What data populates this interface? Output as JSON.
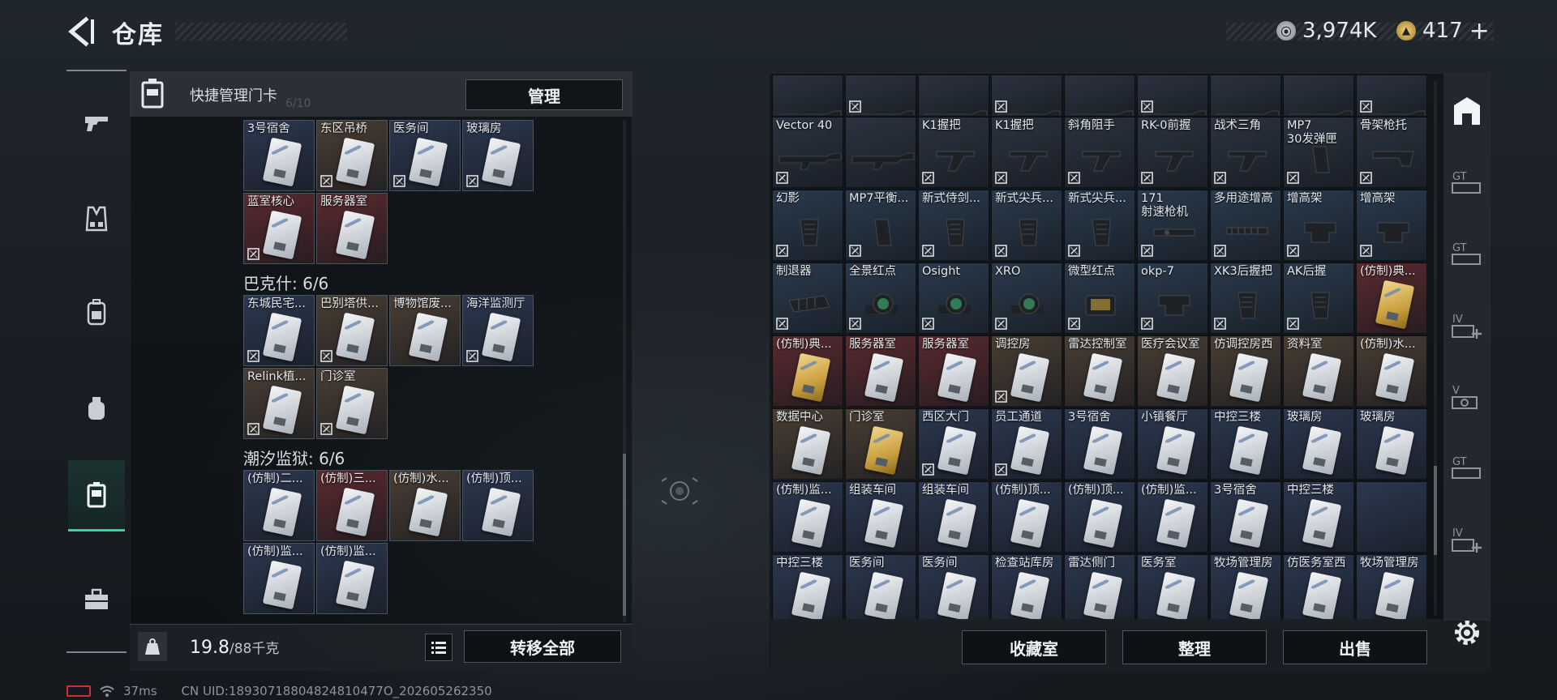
{
  "header": {
    "title": "仓库"
  },
  "currency": {
    "coins": "3,974K",
    "premium": "417",
    "plus": "+"
  },
  "left_nav": [
    "firearm",
    "gear",
    "backpack",
    "consumable",
    "keycard",
    "toolbox"
  ],
  "left_panel": {
    "header_label": "快捷管理门卡",
    "header_faded": "6/10",
    "manage_button": "管理",
    "weight_value": "19.8",
    "weight_max": "/88千克",
    "transfer_all_button": "转移全部",
    "group1_rows": [
      [
        {
          "label": "3号宿舍",
          "bg": "#2c3850",
          "card": "white",
          "locked": false
        },
        {
          "label": "东区吊桥",
          "bg": "#4a3e33",
          "card": "white",
          "locked": true
        },
        {
          "label": "医务间",
          "bg": "#2c3850",
          "card": "white",
          "locked": true
        },
        {
          "label": "玻璃房",
          "bg": "#2c3850",
          "card": "white",
          "locked": true
        }
      ],
      [
        {
          "label": "蓝室核心",
          "bg": "#5a2a2e",
          "card": "white",
          "locked": true
        },
        {
          "label": "服务器室",
          "bg": "#5a2a2e",
          "card": "white",
          "locked": false
        }
      ]
    ],
    "group2_title": "巴克什: 6/6",
    "group2_rows": [
      [
        {
          "label": "东城民宅...",
          "bg": "#2c3850",
          "card": "white",
          "locked": true
        },
        {
          "label": "巴别塔供...",
          "bg": "#4a3e33",
          "card": "white",
          "locked": true
        },
        {
          "label": "博物馆废...",
          "bg": "#4a3e33",
          "card": "white",
          "locked": false
        },
        {
          "label": "海洋监测厅",
          "bg": "#2c3850",
          "card": "white",
          "locked": true
        }
      ],
      [
        {
          "label": "Relink植...",
          "bg": "#4a3e33",
          "card": "white",
          "locked": true
        },
        {
          "label": "门诊室",
          "bg": "#4a3e33",
          "card": "white",
          "locked": true
        }
      ]
    ],
    "group3_title": "潮汐监狱: 6/6",
    "group3_rows": [
      [
        {
          "label": "(仿制)二...",
          "bg": "#2c3850",
          "card": "white",
          "locked": false
        },
        {
          "label": "(仿制)三...",
          "bg": "#5a2a2e",
          "card": "white",
          "locked": false
        },
        {
          "label": "(仿制)水...",
          "bg": "#4a3e33",
          "card": "white",
          "locked": false
        },
        {
          "label": "(仿制)顶...",
          "bg": "#2c3850",
          "card": "white",
          "locked": false
        }
      ],
      [
        {
          "label": "(仿制)监...",
          "bg": "#2c3850",
          "card": "white",
          "locked": false
        },
        {
          "label": "(仿制)监...",
          "bg": "#2c3850",
          "card": "white",
          "locked": false
        }
      ]
    ]
  },
  "status": {
    "ping": "37ms",
    "uid": "CN UID:18930718804824810477O_202605262350"
  },
  "right_panel": {
    "buttons": [
      "收藏室",
      "整理",
      "出售"
    ],
    "rows": [
      [
        {
          "label": "",
          "bg": "#2a3340",
          "kind": "weapon",
          "locked": false
        },
        {
          "label": "",
          "bg": "#2a3340",
          "kind": "weapon",
          "locked": true
        },
        {
          "label": "",
          "bg": "#2a3340",
          "kind": "weapon",
          "locked": false
        },
        {
          "label": "",
          "bg": "#2a3340",
          "kind": "weapon",
          "locked": true
        },
        {
          "label": "",
          "bg": "#2a3340",
          "kind": "weapon",
          "locked": false
        },
        {
          "label": "",
          "bg": "#2a3340",
          "kind": "weapon",
          "locked": true
        },
        {
          "label": "",
          "bg": "#2a3340",
          "kind": "weapon",
          "locked": false
        },
        {
          "label": "",
          "bg": "#2a3340",
          "kind": "weapon",
          "locked": false
        },
        {
          "label": "",
          "bg": "#2a3340",
          "kind": "weapon",
          "locked": true
        }
      ],
      [
        {
          "label": "Vector 40",
          "bg": "#2a3340",
          "kind": "weapon",
          "locked": true
        },
        {
          "label": "",
          "bg": "#2a3340",
          "kind": "weapon",
          "locked": false
        },
        {
          "label": "K1握把",
          "bg": "#2a3340",
          "kind": "grip",
          "locked": true
        },
        {
          "label": "K1握把",
          "bg": "#2a3340",
          "kind": "grip",
          "locked": true
        },
        {
          "label": "斜角阻手",
          "bg": "#2a3340",
          "kind": "grip",
          "locked": true
        },
        {
          "label": "RK-0前握",
          "bg": "#2a3340",
          "kind": "grip",
          "locked": true
        },
        {
          "label": "战术三角",
          "bg": "#2a3340",
          "kind": "grip",
          "locked": true
        },
        {
          "label": "MP7\n30发弹匣",
          "bg": "#2a3340",
          "kind": "mag",
          "locked": true
        },
        {
          "label": "骨架枪托",
          "bg": "#2a3340",
          "kind": "stock",
          "locked": true
        }
      ],
      [
        {
          "label": "幻影",
          "bg": "#2a3a4c",
          "kind": "pistolgrip",
          "locked": true
        },
        {
          "label": "MP7平衡...",
          "bg": "#2a3a4c",
          "kind": "mag",
          "locked": true
        },
        {
          "label": "新式侍剑...",
          "bg": "#2a3a4c",
          "kind": "pistolgrip",
          "locked": true
        },
        {
          "label": "新式尖兵...",
          "bg": "#2a3a4c",
          "kind": "pistolgrip",
          "locked": true
        },
        {
          "label": "新式尖兵...",
          "bg": "#2a3a4c",
          "kind": "pistolgrip",
          "locked": true
        },
        {
          "label": "171\n射速枪机",
          "bg": "#2a3a4c",
          "kind": "part",
          "locked": true
        },
        {
          "label": "多用途增高",
          "bg": "#2a3a4c",
          "kind": "rail",
          "locked": true
        },
        {
          "label": "增高架",
          "bg": "#2a3a4c",
          "kind": "mount",
          "locked": true
        },
        {
          "label": "增高架",
          "bg": "#2a3a4c",
          "kind": "mount",
          "locked": true
        }
      ],
      [
        {
          "label": "制退器",
          "bg": "#2a3a4c",
          "kind": "muzzle",
          "locked": true
        },
        {
          "label": "全景红点",
          "bg": "#2a3a4c",
          "kind": "sight",
          "locked": true
        },
        {
          "label": "Osight",
          "bg": "#2a3a4c",
          "kind": "sight",
          "locked": true
        },
        {
          "label": "XRO",
          "bg": "#2a3a4c",
          "kind": "sight",
          "locked": true
        },
        {
          "label": "微型红点",
          "bg": "#2a3a4c",
          "kind": "sight2",
          "locked": true
        },
        {
          "label": "okp-7",
          "bg": "#2a3a4c",
          "kind": "mount",
          "locked": true
        },
        {
          "label": "XK3后握把",
          "bg": "#2a3a4c",
          "kind": "pistolgrip",
          "locked": true
        },
        {
          "label": "AK后握",
          "bg": "#2a3a4c",
          "kind": "pistolgrip",
          "locked": true
        },
        {
          "label": "(仿制)典...",
          "bg": "#5a2a2e",
          "kind": "goldcard",
          "locked": false
        }
      ],
      [
        {
          "label": "(仿制)典...",
          "bg": "#5a2a2e",
          "kind": "goldcard",
          "locked": false
        },
        {
          "label": "服务器室",
          "bg": "#5a2a2e",
          "kind": "card",
          "locked": false
        },
        {
          "label": "服务器室",
          "bg": "#5a2a2e",
          "kind": "card",
          "locked": false
        },
        {
          "label": "调控房",
          "bg": "#4a3e33",
          "kind": "card",
          "locked": true
        },
        {
          "label": "雷达控制室",
          "bg": "#4a3e33",
          "kind": "card",
          "locked": false
        },
        {
          "label": "医疗会议室",
          "bg": "#4a3e33",
          "kind": "card",
          "locked": false
        },
        {
          "label": "仿调控房西",
          "bg": "#4a3e33",
          "kind": "card",
          "locked": false
        },
        {
          "label": "资料室",
          "bg": "#4a3e33",
          "kind": "card",
          "locked": false
        },
        {
          "label": "(仿制)水...",
          "bg": "#4a3e33",
          "kind": "card",
          "locked": false
        }
      ],
      [
        {
          "label": "数据中心",
          "bg": "#4a3e33",
          "kind": "card",
          "locked": false
        },
        {
          "label": "门诊室",
          "bg": "#4a3e33",
          "kind": "goldcard",
          "locked": false
        },
        {
          "label": "西区大门",
          "bg": "#2c3850",
          "kind": "card",
          "locked": true
        },
        {
          "label": "员工通道",
          "bg": "#2c3850",
          "kind": "card",
          "locked": true
        },
        {
          "label": "3号宿舍",
          "bg": "#2c3850",
          "kind": "card",
          "locked": false
        },
        {
          "label": "小镇餐厅",
          "bg": "#2c3850",
          "kind": "card",
          "locked": false
        },
        {
          "label": "中控三楼",
          "bg": "#2c3850",
          "kind": "card",
          "locked": false
        },
        {
          "label": "玻璃房",
          "bg": "#2c3850",
          "kind": "card",
          "locked": false
        },
        {
          "label": "玻璃房",
          "bg": "#2c3850",
          "kind": "card",
          "locked": false
        }
      ],
      [
        {
          "label": "(仿制)监...",
          "bg": "#2c3850",
          "kind": "card",
          "locked": false
        },
        {
          "label": "组装车间",
          "bg": "#2c3850",
          "kind": "card",
          "locked": false
        },
        {
          "label": "组装车间",
          "bg": "#2c3850",
          "kind": "card",
          "locked": false
        },
        {
          "label": "(仿制)顶...",
          "bg": "#2c3850",
          "kind": "card",
          "locked": false
        },
        {
          "label": "(仿制)顶...",
          "bg": "#2c3850",
          "kind": "card",
          "locked": false
        },
        {
          "label": "(仿制)监...",
          "bg": "#2c3850",
          "kind": "card",
          "locked": false
        },
        {
          "label": "3号宿舍",
          "bg": "#2c3850",
          "kind": "card",
          "locked": false
        },
        {
          "label": "中控三楼",
          "bg": "#2c3850",
          "kind": "card",
          "locked": false
        },
        {
          "label": "",
          "bg": "#2c3850",
          "kind": "empty",
          "locked": false
        }
      ],
      [
        {
          "label": "中控三楼",
          "bg": "#2c3850",
          "kind": "card",
          "locked": false
        },
        {
          "label": "医务间",
          "bg": "#2c3850",
          "kind": "card",
          "locked": false
        },
        {
          "label": "医务间",
          "bg": "#2c3850",
          "kind": "card",
          "locked": false
        },
        {
          "label": "检查站库房",
          "bg": "#2c3850",
          "kind": "card",
          "locked": false
        },
        {
          "label": "雷达侧门",
          "bg": "#2c3850",
          "kind": "card",
          "locked": false
        },
        {
          "label": "医务室",
          "bg": "#2c3850",
          "kind": "card",
          "locked": false
        },
        {
          "label": "牧场管理房",
          "bg": "#2c3850",
          "kind": "card",
          "locked": false
        },
        {
          "label": "仿医务室西",
          "bg": "#2c3850",
          "kind": "card",
          "locked": false
        },
        {
          "label": "牧场管理房",
          "bg": "#2c3850",
          "kind": "card",
          "locked": false
        }
      ]
    ]
  },
  "category_bar": [
    "arch-icon",
    "gt-icon",
    "gt-icon",
    "iv-plus-icon",
    "v-icon",
    "gt-icon",
    "iv-plus-icon"
  ],
  "colors": {
    "accent": "#31d6a4",
    "panel_header": "#343a42",
    "button_bg": "#0f1215"
  }
}
